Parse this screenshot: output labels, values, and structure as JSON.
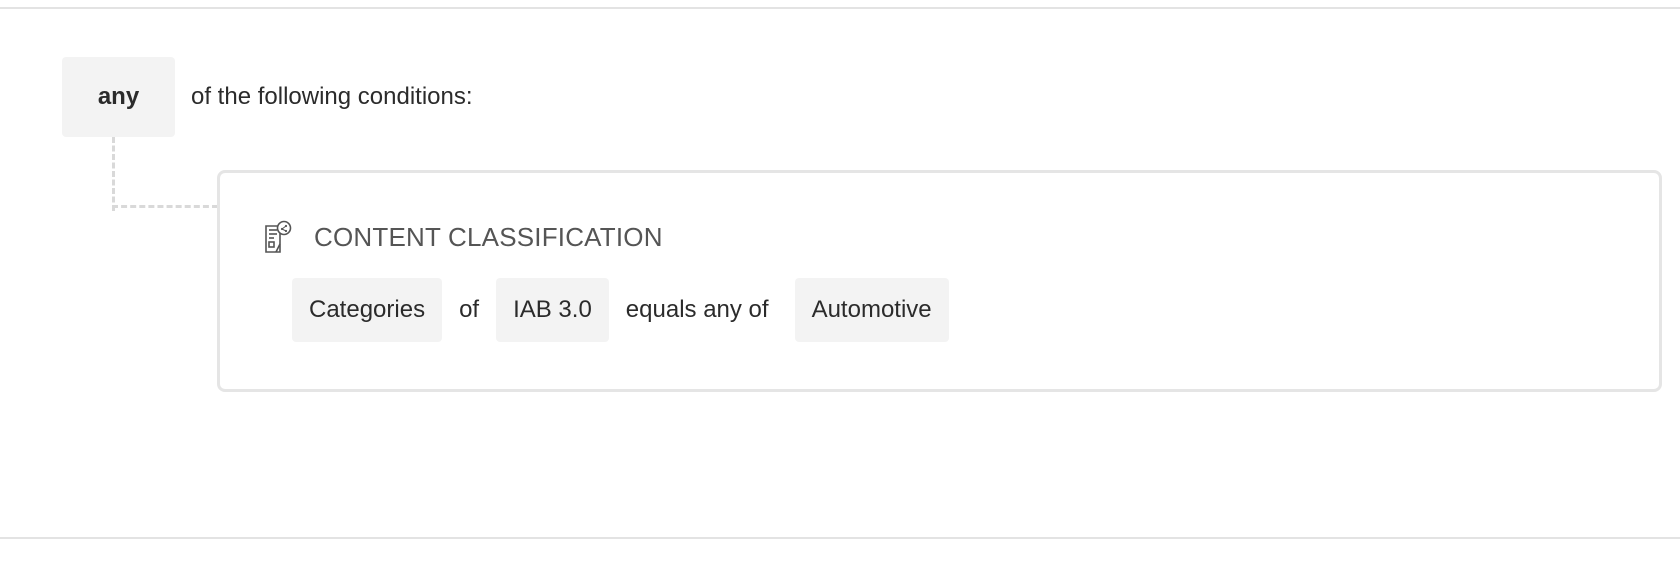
{
  "rule": {
    "match_mode": "any",
    "match_suffix": "of the following conditions:"
  },
  "condition": {
    "icon": "content-classification-icon",
    "title": "CONTENT CLASSIFICATION",
    "field": "Categories",
    "connector_of": "of",
    "taxonomy": "IAB 3.0",
    "operator": "equals any of",
    "value": "Automotive"
  },
  "colors": {
    "chip_bg": "#f3f3f3",
    "card_border": "#e5e5e5",
    "connector": "#d9d9d9",
    "text": "#2b2b2b",
    "title_text": "#555555"
  }
}
